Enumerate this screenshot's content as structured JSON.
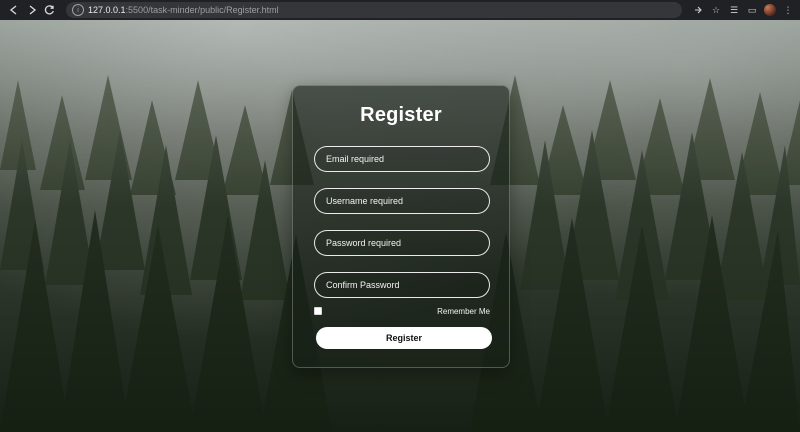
{
  "browser": {
    "url_host": "127.0.0.1",
    "url_path": ":5500/task-minder/public/Register.html",
    "icons": {
      "back": "arrow-left-icon",
      "forward": "arrow-right-icon",
      "refresh": "refresh-icon",
      "info": "info-icon",
      "share": "share-icon",
      "star": "star-icon",
      "playlist": "playlist-icon",
      "sidebar": "sidebar-icon",
      "profile": "avatar"
    }
  },
  "form": {
    "title": "Register",
    "fields": {
      "email": "Email required",
      "username": "Username required",
      "password": "Password required",
      "confirm": "Confirm Password"
    },
    "remember_label": "Remember Me",
    "submit_label": "Register"
  }
}
